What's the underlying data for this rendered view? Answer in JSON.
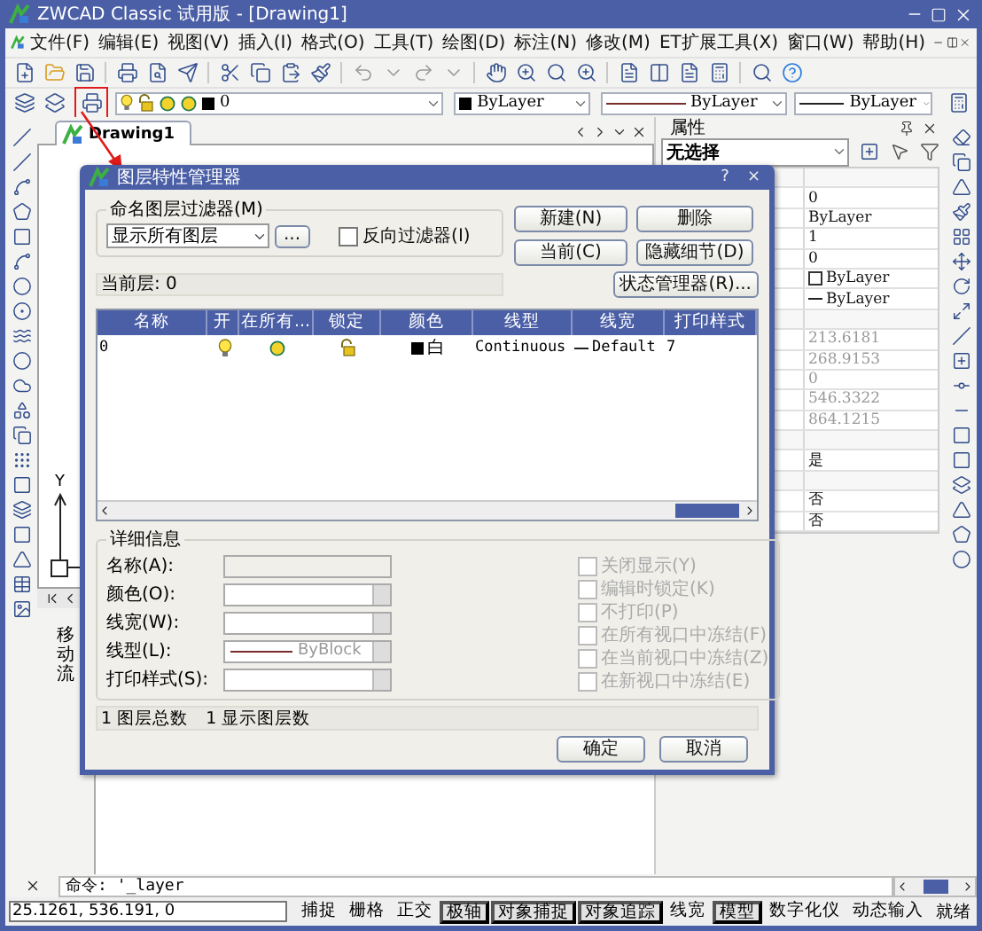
{
  "window": {
    "title": "ZWCAD Classic 试用版 - [Drawing1]"
  },
  "menu": [
    "文件(F)",
    "编辑(E)",
    "视图(V)",
    "插入(I)",
    "格式(O)",
    "工具(T)",
    "绘图(D)",
    "标注(N)",
    "修改(M)",
    "ET扩展工具(X)",
    "窗口(W)",
    "帮助(H)"
  ],
  "layer_toolbar": {
    "layer": "0",
    "color_setting": "ByLayer",
    "linetype": "ByLayer",
    "lineweight": "ByLayer"
  },
  "document_tab": {
    "label": "Drawing1",
    "selected": true
  },
  "ucs_label": "Y",
  "side_palette": {
    "title": "移动流"
  },
  "properties": {
    "title": "属性",
    "selection": "无选择",
    "rows": [
      {
        "kind": "section"
      },
      {
        "kind": "value",
        "value": "0",
        "disabled": false
      },
      {
        "kind": "value",
        "value": "ByLayer",
        "disabled": false
      },
      {
        "kind": "value",
        "value": "1",
        "disabled": false
      },
      {
        "kind": "value",
        "value": "0",
        "disabled": false
      },
      {
        "kind": "color",
        "value": "ByLayer",
        "disabled": false
      },
      {
        "kind": "linetype",
        "value": "ByLayer",
        "disabled": false
      },
      {
        "kind": "section"
      },
      {
        "kind": "value",
        "value": "213.6181",
        "disabled": true
      },
      {
        "kind": "value",
        "value": "268.9153",
        "disabled": true
      },
      {
        "kind": "value",
        "value": "0",
        "disabled": true
      },
      {
        "kind": "value",
        "value": "546.3322",
        "disabled": true
      },
      {
        "kind": "value",
        "value": "864.1215",
        "disabled": true
      },
      {
        "kind": "section"
      },
      {
        "kind": "value",
        "value": "是",
        "disabled": false
      },
      {
        "kind": "section"
      },
      {
        "kind": "value",
        "value": "否",
        "disabled": false
      },
      {
        "kind": "value",
        "value": "否",
        "disabled": false
      }
    ]
  },
  "command_line": {
    "text": "命令: '_layer"
  },
  "status_bar": {
    "coordinates": "25.1261,  536.191,  0",
    "toggles": [
      {
        "label": "捕捉",
        "on": false
      },
      {
        "label": "栅格",
        "on": false
      },
      {
        "label": "正交",
        "on": false
      },
      {
        "label": "极轴",
        "on": true
      },
      {
        "label": "对象捕捉",
        "on": true
      },
      {
        "label": "对象追踪",
        "on": true
      },
      {
        "label": "线宽",
        "on": false
      },
      {
        "label": "模型",
        "on": true
      },
      {
        "label": "数字化仪",
        "on": false
      },
      {
        "label": "动态输入",
        "on": false
      }
    ],
    "status": "就绪"
  },
  "dialog": {
    "title": "图层特性管理器",
    "controls": [
      "?",
      "×"
    ],
    "filter_group": {
      "title": "命名图层过滤器(M)",
      "filter": "显示所有图层",
      "browse": "...",
      "invert": {
        "label": "反向过滤器(I)",
        "checked": false
      }
    },
    "buttons": [
      "新建(N)",
      "删除",
      "当前(C)",
      "隐藏细节(D)"
    ],
    "state_manager": "状态管理器(R)...",
    "current_layer": "当前层: 0",
    "table": {
      "columns": [
        "名称",
        "开",
        "在所有...",
        "锁定",
        "颜色",
        "线型",
        "线宽",
        "打印样式"
      ],
      "rows": [
        {
          "name": "0",
          "on": true,
          "frozen": false,
          "locked": false,
          "color_name": "白",
          "linetype": "Continuous",
          "lineweight": "Default",
          "plot_style": "7"
        }
      ]
    },
    "details": {
      "title": "详细信息",
      "fields": [
        {
          "label": "名称(A):",
          "kind": "text"
        },
        {
          "label": "颜色(O):",
          "kind": "combo"
        },
        {
          "label": "线宽(W):",
          "kind": "combo"
        },
        {
          "label": "线型(L):",
          "kind": "linetype",
          "value": "ByBlock"
        },
        {
          "label": "打印样式(S):",
          "kind": "combo"
        }
      ],
      "options": [
        {
          "label": "关闭显示(Y)",
          "checked": false,
          "disabled": true
        },
        {
          "label": "编辑时锁定(K)",
          "checked": false,
          "disabled": true
        },
        {
          "label": "不打印(P)",
          "checked": false,
          "disabled": true
        },
        {
          "label": "在所有视口中冻结(F)",
          "checked": false,
          "disabled": true
        },
        {
          "label": "在当前视口中冻结(Z)",
          "checked": false,
          "disabled": true
        },
        {
          "label": "在新视口中冻结(E)",
          "checked": false,
          "disabled": true
        }
      ]
    },
    "counts": [
      "1 图层总数",
      "1 显示图层数"
    ],
    "footer_buttons": [
      "确定",
      "取消"
    ]
  }
}
